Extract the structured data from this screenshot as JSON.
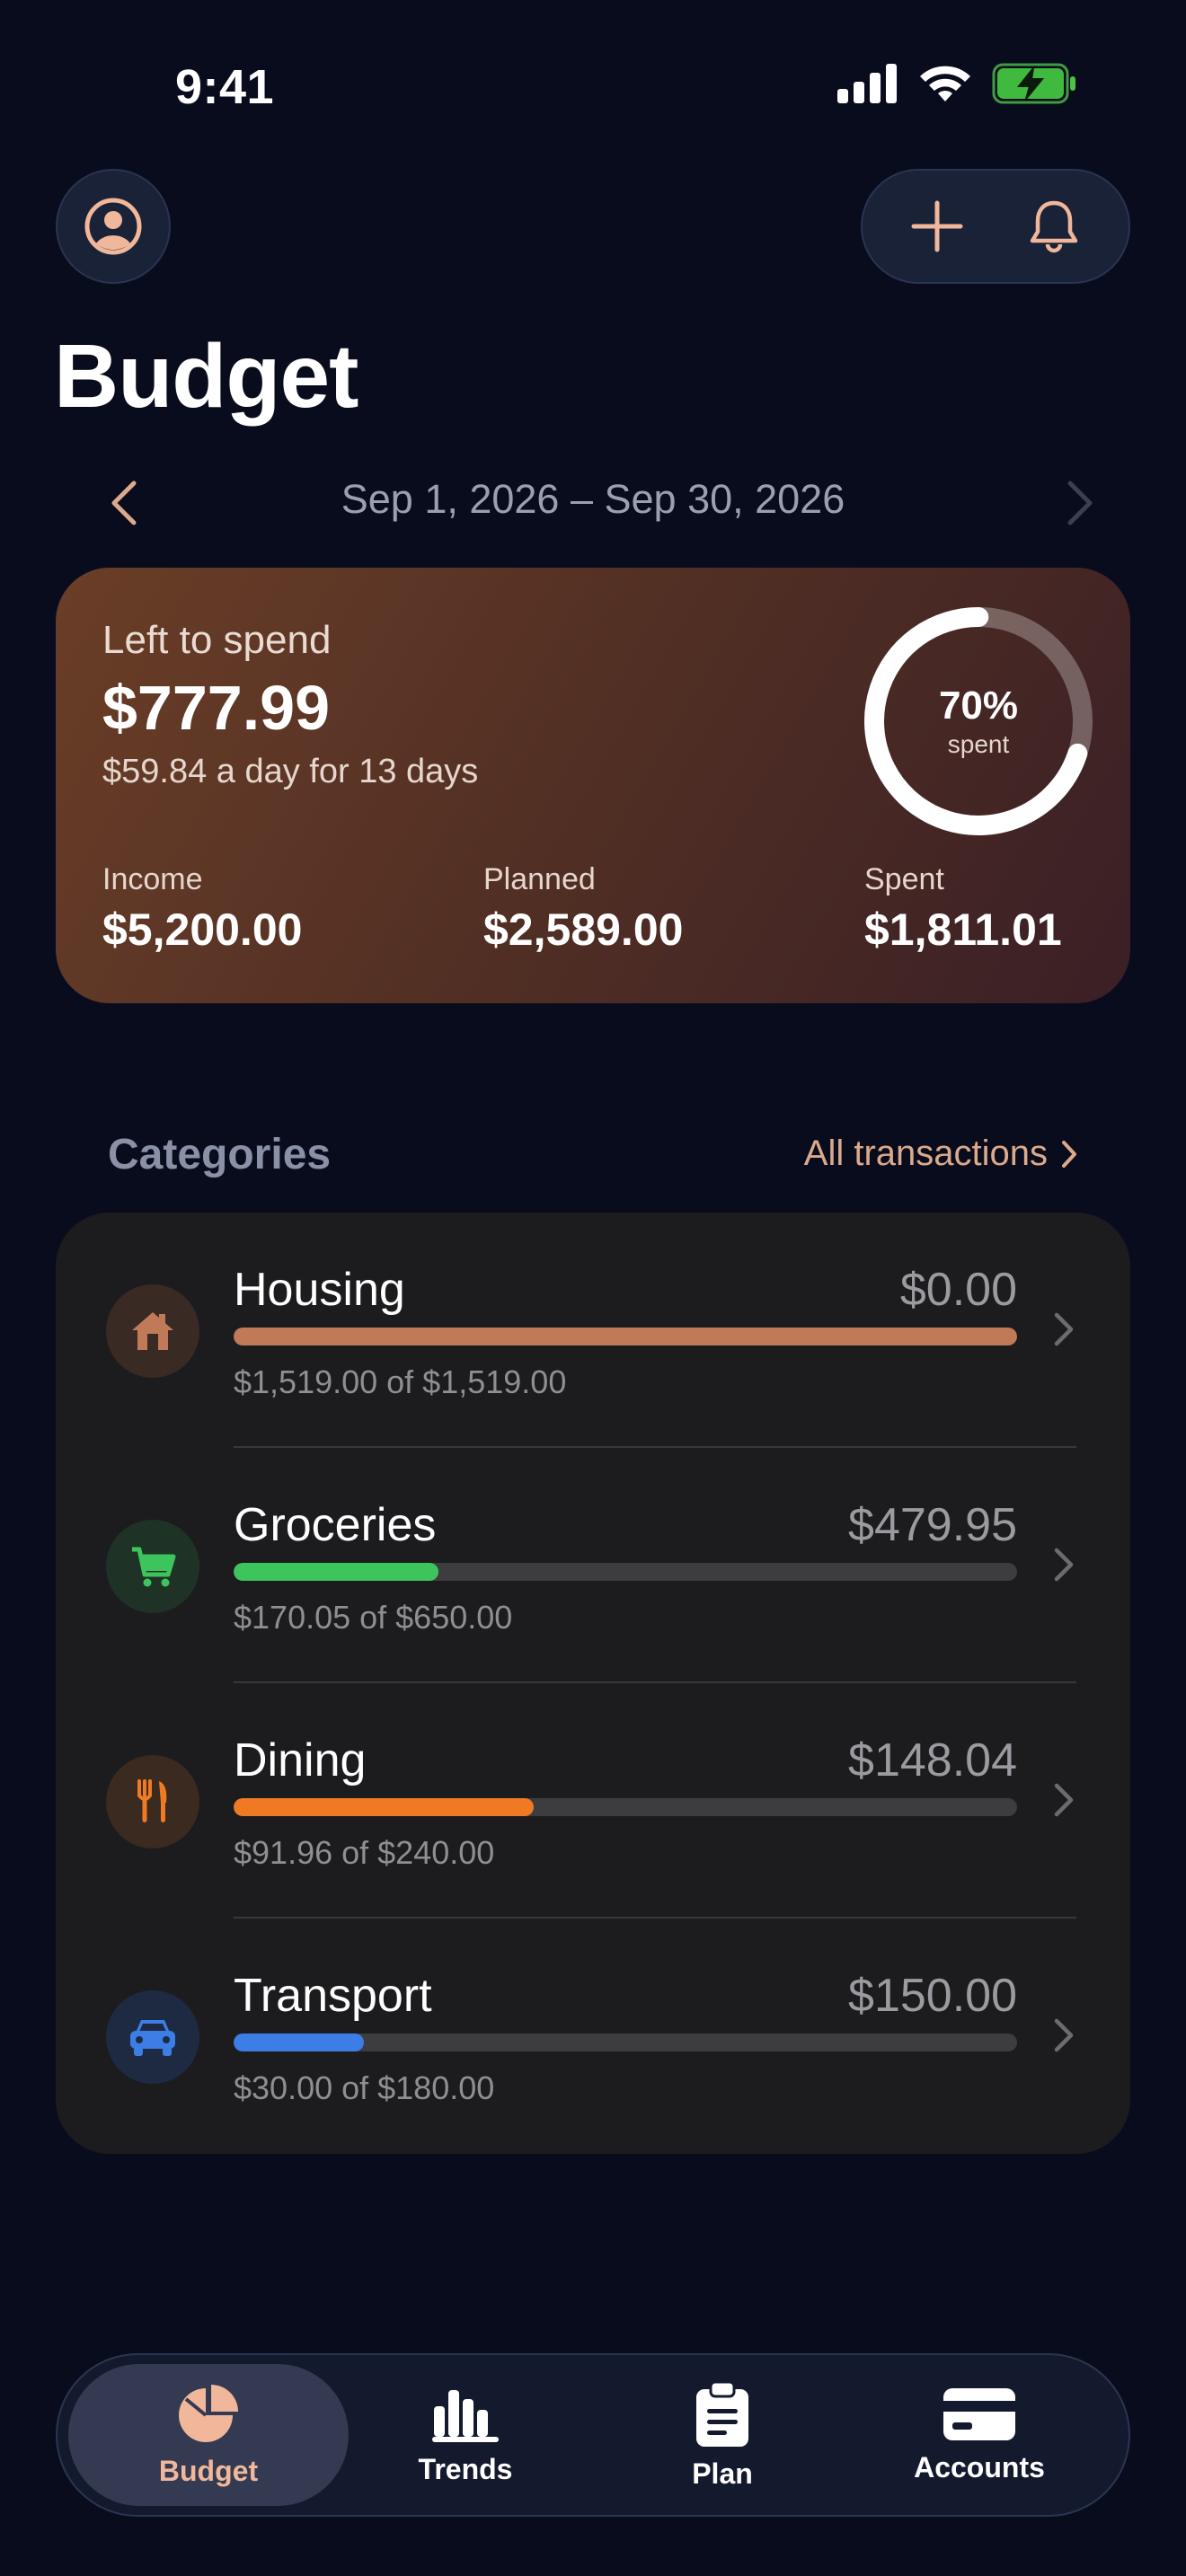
{
  "status_bar": {
    "time": "9:41"
  },
  "header": {
    "title": "Budget"
  },
  "period": {
    "range": "Sep 1, 2026 – Sep 30, 2026"
  },
  "summary": {
    "left_label": "Left to spend",
    "left_amount": "$777.99",
    "daily": "$59.84 a day for 13 days",
    "ring_percent_label": "70%",
    "ring_percent_value": 0.7,
    "ring_sub": "spent",
    "income_label": "Income",
    "income": "$5,200.00",
    "planned_label": "Planned",
    "planned": "$2,589.00",
    "spent_label": "Spent",
    "spent": "$1,811.01"
  },
  "categories": {
    "title": "Categories",
    "all_link": "All transactions",
    "items": [
      {
        "name": "Housing",
        "remaining": "$0.00",
        "progress_text": "$1,519.00 of $1,519.00",
        "progress": 1.0,
        "color": "#c07a58",
        "icon_bg": "#3a2a24",
        "icon": "house-icon"
      },
      {
        "name": "Groceries",
        "remaining": "$479.95",
        "progress_text": "$170.05 of $650.00",
        "progress": 0.2616,
        "color": "#3ec45c",
        "icon_bg": "#1e3326",
        "icon": "cart-icon"
      },
      {
        "name": "Dining",
        "remaining": "$148.04",
        "progress_text": "$91.96 of $240.00",
        "progress": 0.3832,
        "color": "#f07a24",
        "icon_bg": "#3a2a20",
        "icon": "fork-knife-icon"
      },
      {
        "name": "Transport",
        "remaining": "$150.00",
        "progress_text": "$30.00 of $180.00",
        "progress": 0.1667,
        "color": "#3c7ee6",
        "icon_bg": "#1e2a42",
        "icon": "car-icon"
      }
    ]
  },
  "tabs": [
    {
      "label": "Budget",
      "icon": "pie-chart-icon",
      "active": true
    },
    {
      "label": "Trends",
      "icon": "bar-chart-icon",
      "active": false
    },
    {
      "label": "Plan",
      "icon": "clipboard-icon",
      "active": false
    },
    {
      "label": "Accounts",
      "icon": "card-icon",
      "active": false
    }
  ],
  "colors": {
    "accent": "#f0b79a",
    "background": "#080c1d"
  }
}
